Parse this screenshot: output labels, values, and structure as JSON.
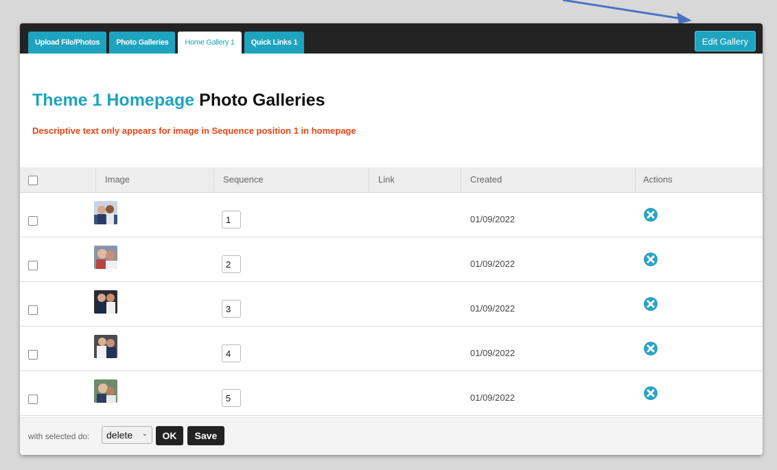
{
  "tabs": [
    {
      "label": "Upload File/Photos",
      "active": false
    },
    {
      "label": "Photo Galleries",
      "active": false
    },
    {
      "label": "Home Gallery 1",
      "active": true
    },
    {
      "label": "Quick Links 1",
      "active": false
    }
  ],
  "edit_button": "Edit Gallery",
  "title": {
    "accent": "Theme 1 Homepage",
    "rest": "Photo Galleries"
  },
  "notice": "Descriptive text only appears for image in Sequence position 1 in homepage",
  "table": {
    "columns": [
      "Image",
      "Sequence",
      "Link",
      "Created",
      "Actions"
    ],
    "rows": [
      {
        "sequence": "1",
        "link": "",
        "created": "01/09/2022"
      },
      {
        "sequence": "2",
        "link": "",
        "created": "01/09/2022"
      },
      {
        "sequence": "3",
        "link": "",
        "created": "01/09/2022"
      },
      {
        "sequence": "4",
        "link": "",
        "created": "01/09/2022"
      },
      {
        "sequence": "5",
        "link": "",
        "created": "01/09/2022"
      }
    ]
  },
  "footer": {
    "label": "with selected do:",
    "select_value": "delete",
    "ok_label": "OK",
    "save_label": "Save"
  },
  "colors": {
    "accent": "#1ea4bf",
    "notice": "#e64414",
    "tabbar": "#232323",
    "annotation_arrow": "#4a72c4"
  },
  "icons": {
    "delete_action": "circle-x-icon",
    "select_chevron": "chevron-down-icon"
  }
}
